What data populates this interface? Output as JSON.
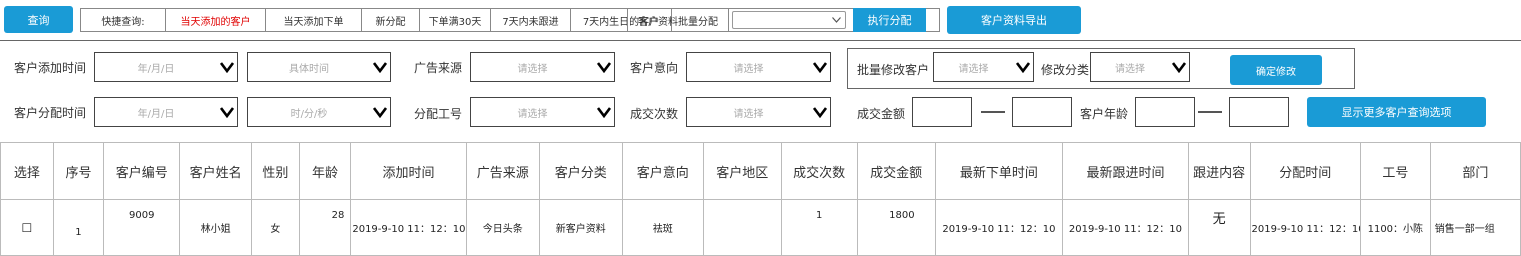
{
  "toolbar": {
    "query_btn": "查询",
    "quick_label": "快捷查询:",
    "quick_items": [
      "当天添加的客户",
      "当天添加下单",
      "新分配",
      "下单满30天",
      "7天内未跟进",
      "7天内生日的客户"
    ],
    "batch_assign_label": "客户资料批量分配",
    "batch_assign_value": "",
    "execute_btn": "执行分配",
    "export_btn": "客户资料导出"
  },
  "filters": {
    "add_time_label": "客户添加时间",
    "add_date_placeholder": "年/月/日",
    "add_time_placeholder": "具体时间",
    "ad_source_label": "广告来源",
    "ad_source_placeholder": "请选择",
    "intent_label": "客户意向",
    "intent_placeholder": "请选择",
    "assign_time_label": "客户分配时间",
    "assign_date_placeholder": "年/月/日",
    "assign_time_placeholder": "时/分/秒",
    "staff_no_label": "分配工号",
    "staff_no_placeholder": "请选择",
    "deal_count_label": "成交次数",
    "deal_count_placeholder": "请选择",
    "deal_amount_label": "成交金额",
    "age_label": "客户年龄",
    "batch_edit_label": "批量修改客户",
    "batch_edit_placeholder": "请选择",
    "edit_category_label": "修改分类",
    "edit_category_placeholder": "请选择",
    "confirm_btn": "确定修改",
    "more_btn": "显示更多客户查询选项"
  },
  "table": {
    "headers": [
      "选择",
      "序号",
      "客户编号",
      "客户姓名",
      "性别",
      "年龄",
      "添加时间",
      "广告来源",
      "客户分类",
      "客户意向",
      "客户地区",
      "成交次数",
      "成交金额",
      "最新下单时间",
      "最新跟进时间",
      "跟进内容",
      "分配时间",
      "工号",
      "部门"
    ],
    "rows": [
      {
        "checkbox": "☐",
        "index": "1",
        "customer_id": "9009",
        "name": "林小姐",
        "gender": "女",
        "age": "28",
        "add_time": "2019-9-10 11：12：10",
        "ad_source": "今日头条",
        "category": "新客户资料",
        "intent": "祛斑",
        "region": "",
        "deal_count": "1",
        "deal_amount": "1800",
        "last_order_time": "2019-9-10 11：12：10",
        "last_follow_time": "2019-9-10 11：12：10",
        "follow_content": "无",
        "assign_time": "2019-9-10 11：12：10",
        "staff_no": "1100：小陈",
        "department": "销售一部一组"
      }
    ]
  },
  "colors": {
    "accent": "#1a9bd6",
    "highlight": "#e00000"
  }
}
